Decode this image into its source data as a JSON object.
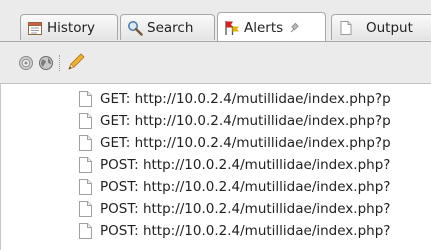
{
  "tabs": [
    {
      "label": "History",
      "icon": "calendar-icon",
      "active": false
    },
    {
      "label": "Search",
      "icon": "magnifier-icon",
      "active": false
    },
    {
      "label": "Alerts",
      "icon": "flags-icon",
      "active": true,
      "pinned": true
    },
    {
      "label": "Output",
      "icon": "document-icon",
      "active": false
    }
  ],
  "toolbar": {
    "buttons": [
      "target-icon",
      "globe-icon",
      "pencil-icon"
    ]
  },
  "alerts": {
    "items": [
      "GET: http://10.0.2.4/mutillidae/index.php?p",
      "GET: http://10.0.2.4/mutillidae/index.php?p",
      "GET: http://10.0.2.4/mutillidae/index.php?p",
      "POST: http://10.0.2.4/mutillidae/index.php?",
      "POST: http://10.0.2.4/mutillidae/index.php?",
      "POST: http://10.0.2.4/mutillidae/index.php?",
      "POST: http://10.0.2.4/mutillidae/index.php?"
    ]
  },
  "colors": {
    "flag_red": "#d42020",
    "flag_yellow": "#e8b000",
    "pencil": "#e8a020"
  }
}
